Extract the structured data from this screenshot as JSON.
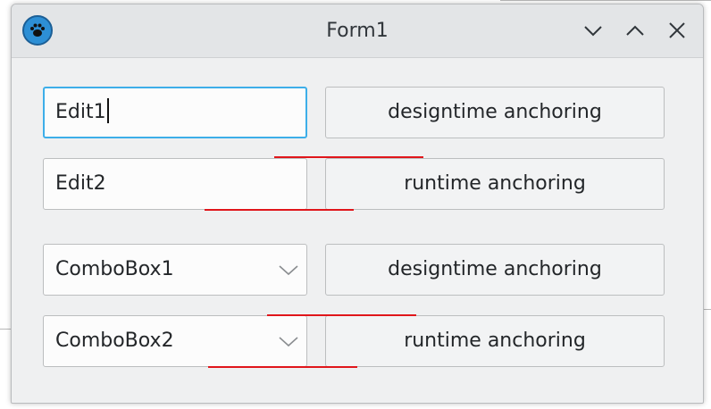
{
  "window": {
    "title": "Form1"
  },
  "titlebar": {
    "app_icon": "paw-icon",
    "buttons": [
      "minimize-chevron-down-icon",
      "maximize-chevron-up-icon",
      "close-x-icon"
    ]
  },
  "rows": {
    "edit1": {
      "value": "Edit1"
    },
    "edit2": {
      "value": "Edit2"
    },
    "combo1": {
      "value": "ComboBox1"
    },
    "combo2": {
      "value": "ComboBox2"
    },
    "btn1": {
      "label": "designtime anchoring"
    },
    "btn2": {
      "label": "runtime anchoring"
    },
    "btn3": {
      "label": "designtime anchoring"
    },
    "btn4": {
      "label": "runtime anchoring"
    }
  },
  "colors": {
    "focus": "#3daee9",
    "marker": "#e0161b",
    "window_bg": "#eff0f1"
  }
}
